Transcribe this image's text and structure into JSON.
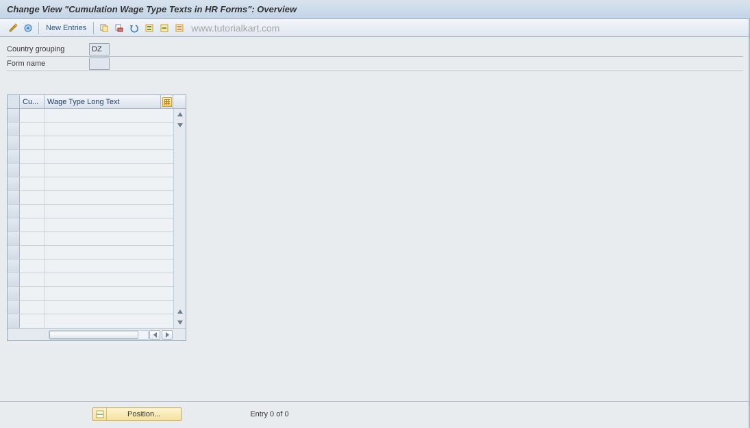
{
  "title": "Change View \"Cumulation Wage Type Texts in HR Forms\": Overview",
  "toolbar": {
    "new_entries": "New Entries"
  },
  "watermark": "www.tutorialkart.com",
  "selection": {
    "country_grouping_label": "Country grouping",
    "country_grouping_value": "DZ",
    "form_name_label": "Form name",
    "form_name_value": ""
  },
  "table": {
    "col_cu": "Cu...",
    "col_wage": "Wage Type Long Text"
  },
  "footer": {
    "position_label": "Position...",
    "entry_text": "Entry 0 of 0"
  }
}
